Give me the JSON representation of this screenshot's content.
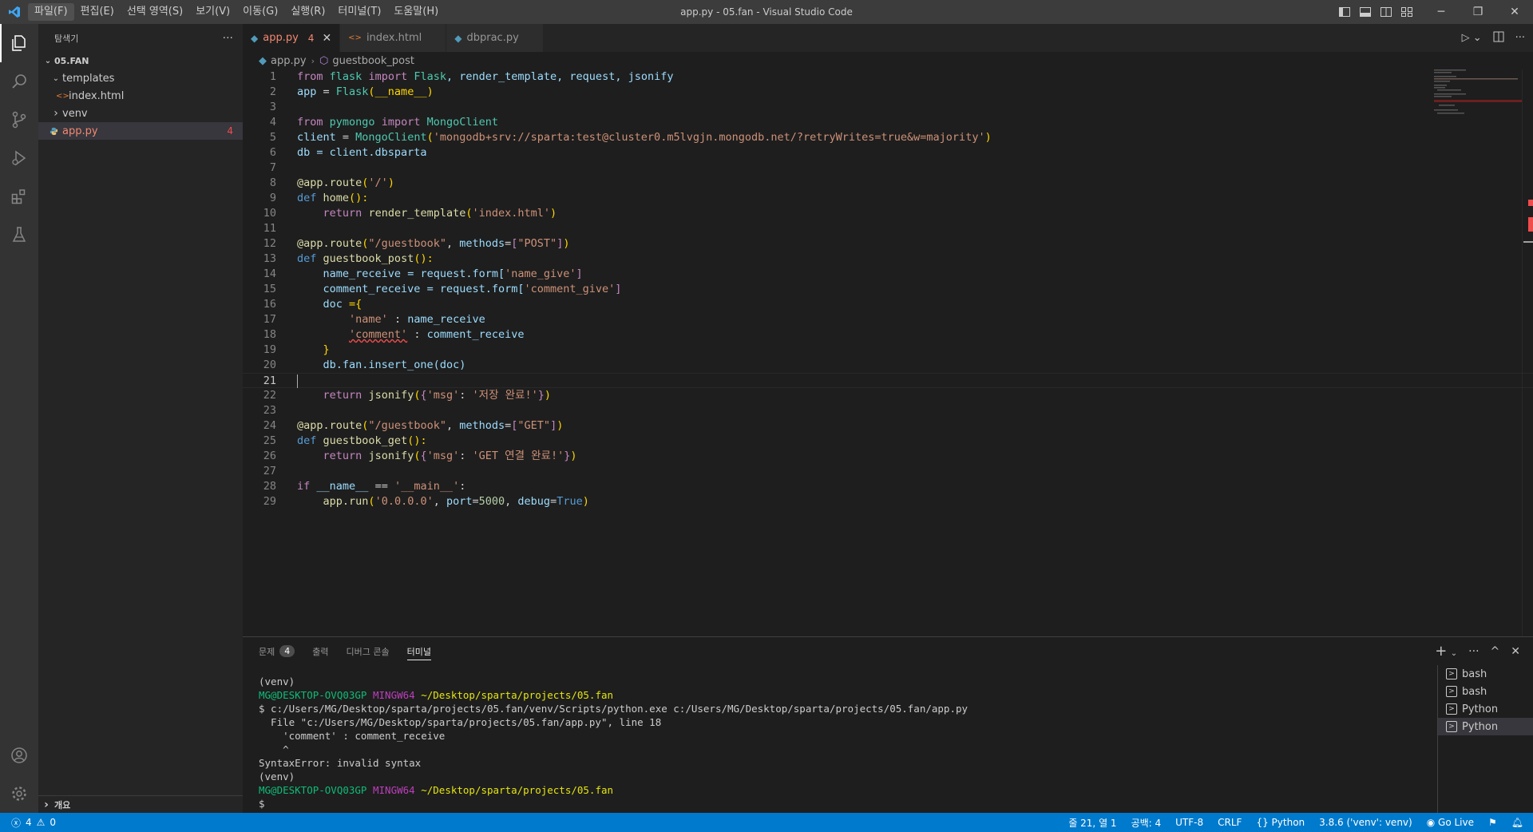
{
  "window": {
    "title": "app.py - 05.fan - Visual Studio Code",
    "menu": [
      "파일(F)",
      "편집(E)",
      "선택 영역(S)",
      "보기(V)",
      "이동(G)",
      "실행(R)",
      "터미널(T)",
      "도움말(H)"
    ],
    "controls": {
      "minimize": "─",
      "restore": "❐",
      "close": "✕"
    }
  },
  "sidebar": {
    "title": "탐색기",
    "more": "···",
    "folder": "05.FAN",
    "items": [
      {
        "label": "templates",
        "chevron": "⌄"
      },
      {
        "label": "index.html",
        "icon": "<>"
      },
      {
        "label": "venv",
        "chevron": "›"
      },
      {
        "label": "app.py",
        "count": "4"
      }
    ],
    "outline": "개요"
  },
  "tabs": [
    {
      "label": "app.py",
      "count": "4",
      "close": "✕"
    },
    {
      "label": "index.html"
    },
    {
      "label": "dbprac.py"
    }
  ],
  "breadcrumb": {
    "file": "app.py",
    "symbol": "guestbook_post"
  },
  "editor": {
    "line_numbers": [
      "1",
      "2",
      "3",
      "4",
      "5",
      "6",
      "7",
      "8",
      "9",
      "10",
      "11",
      "12",
      "13",
      "14",
      "15",
      "16",
      "17",
      "18",
      "19",
      "20",
      "21",
      "22",
      "23",
      "24",
      "25",
      "26",
      "27",
      "28",
      "29"
    ],
    "code": {
      "l1": {
        "kw_from": "from",
        "mod": "flask",
        "kw_import": "import",
        "cls": "Flask",
        "rest": ", render_template, request, jsonify"
      },
      "l2": {
        "var": "app",
        "eq": " = ",
        "cls": "Flask",
        "arg": "(__name__)"
      },
      "l4": {
        "kw_from": "from",
        "mod": "pymongo",
        "kw_import": "import",
        "cls": "MongoClient"
      },
      "l5": {
        "var": "client",
        "eq": " = ",
        "cls": "MongoClient",
        "str": "'mongodb+srv://sparta:test@cluster0.m5lvgjn.mongodb.net/?retryWrites=true&w=majority'"
      },
      "l6": {
        "text": "db = client.dbsparta"
      },
      "l8": {
        "deco": "@app.route",
        "str": "'/'"
      },
      "l9": {
        "kw": "def",
        "fn": "home",
        "rest": "():"
      },
      "l10": {
        "kw": "return",
        "fn": "render_template",
        "str": "'index.html'"
      },
      "l12": {
        "deco": "@app.route",
        "str": "\"/guestbook\"",
        "kwarg": "methods",
        "str2": "\"POST\""
      },
      "l13": {
        "kw": "def",
        "fn": "guestbook_post",
        "rest": "():"
      },
      "l14": {
        "var": "name_receive",
        "mid": " = request.form[",
        "str": "'name_give'",
        "end": "]"
      },
      "l15": {
        "var": "comment_receive",
        "mid": " = request.form[",
        "str": "'comment_give'",
        "end": "]"
      },
      "l16": {
        "var": "doc",
        "rest": " ={"
      },
      "l17": {
        "str": "'name'",
        "sep": " : ",
        "var": "name_receive"
      },
      "l18": {
        "str": "'comment'",
        "sep": " : ",
        "var": "comment_receive"
      },
      "l19": {
        "text": "}"
      },
      "l20": {
        "text": "db.fan.insert_one(doc)"
      },
      "l22": {
        "kw": "return",
        "fn": "jsonify",
        "str1": "'msg'",
        "str2": "'저장 완료!'"
      },
      "l24": {
        "deco": "@app.route",
        "str": "\"/guestbook\"",
        "kwarg": "methods",
        "str2": "\"GET\""
      },
      "l25": {
        "kw": "def",
        "fn": "guestbook_get",
        "rest": "():"
      },
      "l26": {
        "kw": "return",
        "fn": "jsonify",
        "str1": "'msg'",
        "str2": "'GET 연결 완료!'"
      },
      "l28": {
        "kw": "if",
        "var": "__name__",
        "op": " == ",
        "str": "'__main__'",
        "end": ":"
      },
      "l29": {
        "fn": "app.run",
        "str": "'0.0.0.0'",
        "port_kw": "port",
        "port": "5000",
        "debug_kw": "debug",
        "debug": "True"
      }
    }
  },
  "panel": {
    "tabs": [
      {
        "label": "문제",
        "badge": "4"
      },
      {
        "label": "출력"
      },
      {
        "label": "디버그 콘솔"
      },
      {
        "label": "터미널"
      }
    ],
    "actions": {
      "add": "+",
      "more": "···",
      "maximize": "^",
      "close": "✕"
    },
    "terminal": {
      "venv1": "(venv)",
      "prompt_user": "MG@DESKTOP-OVQ03GP",
      "prompt_env": "MINGW64",
      "prompt_path": "~/Desktop/sparta/projects/05.fan",
      "command": "$ c:/Users/MG/Desktop/sparta/projects/05.fan/venv/Scripts/python.exe c:/Users/MG/Desktop/sparta/projects/05.fan/app.py",
      "err1": "  File \"c:/Users/MG/Desktop/sparta/projects/05.fan/app.py\", line 18",
      "err2": "    'comment' : comment_receive",
      "err3": "    ^",
      "err4": "SyntaxError: invalid syntax",
      "venv2": "(venv)",
      "prompt_end": "$"
    },
    "terminal_list": [
      "bash",
      "bash",
      "Python",
      "Python"
    ]
  },
  "statusbar": {
    "errors": "4",
    "warnings": "0",
    "position": "줄 21, 열 1",
    "spaces": "공백: 4",
    "encoding": "UTF-8",
    "eol": "CRLF",
    "language": "Python",
    "interpreter": "3.8.6 ('venv': venv)",
    "golive": "Go Live"
  },
  "colors": {
    "accent": "#007acc",
    "error": "#f14c4c"
  }
}
